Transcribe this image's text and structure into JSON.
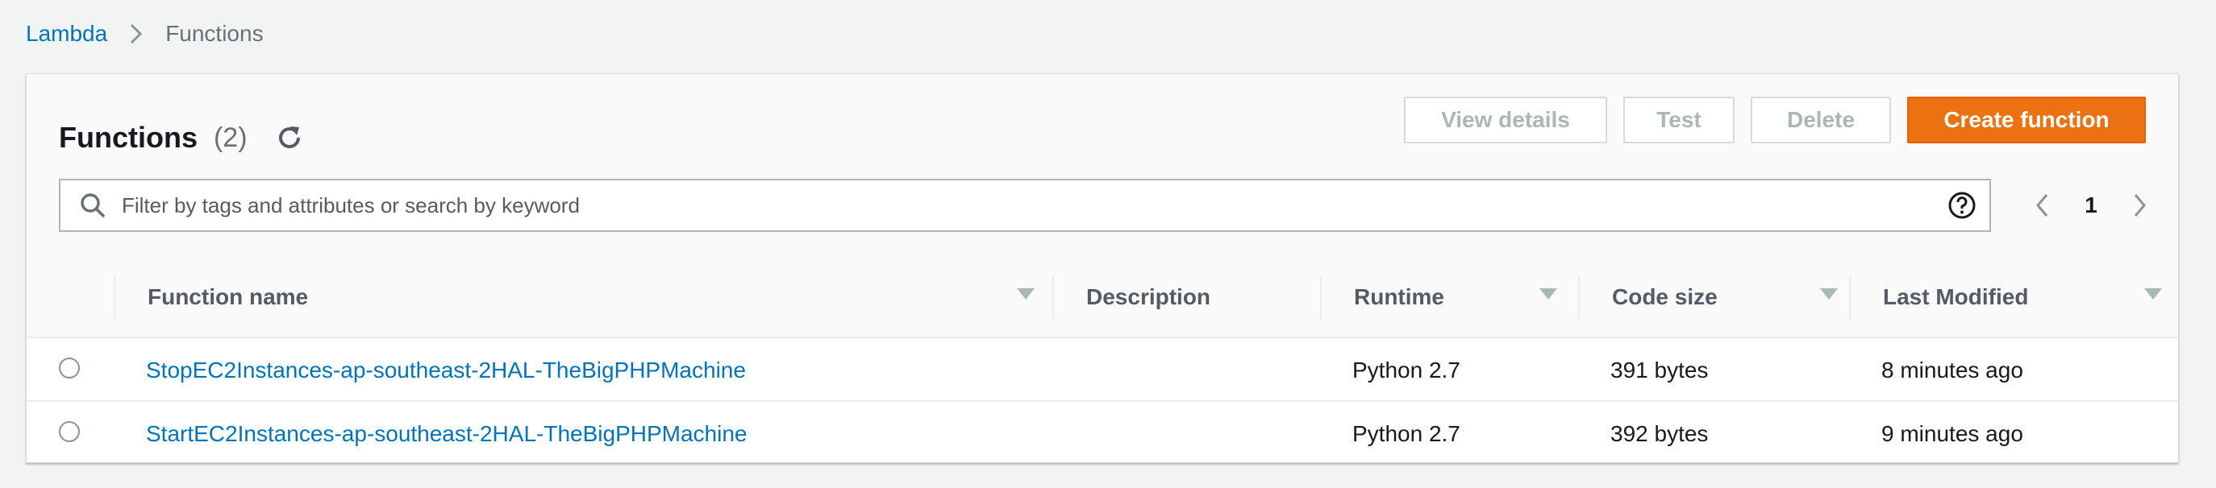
{
  "breadcrumb": {
    "root": "Lambda",
    "current": "Functions"
  },
  "panel": {
    "title": "Functions",
    "count": "(2)"
  },
  "actions": {
    "view_details": "View details",
    "test": "Test",
    "delete": "Delete",
    "create": "Create function"
  },
  "search": {
    "placeholder": "Filter by tags and attributes or search by keyword"
  },
  "pagination": {
    "current_page": "1"
  },
  "table": {
    "columns": {
      "name": "Function name",
      "description": "Description",
      "runtime": "Runtime",
      "code_size": "Code size",
      "last_modified": "Last Modified"
    },
    "rows": [
      {
        "name": "StopEC2Instances-ap-southeast-2HAL-TheBigPHPMachine",
        "description": "",
        "runtime": "Python 2.7",
        "code_size": "391 bytes",
        "last_modified": "8 minutes ago"
      },
      {
        "name": "StartEC2Instances-ap-southeast-2HAL-TheBigPHPMachine",
        "description": "",
        "runtime": "Python 2.7",
        "code_size": "392 bytes",
        "last_modified": "9 minutes ago"
      }
    ]
  },
  "colors": {
    "primary": "#ec7211",
    "link": "#0073bb",
    "background": "#f2f3f3"
  }
}
